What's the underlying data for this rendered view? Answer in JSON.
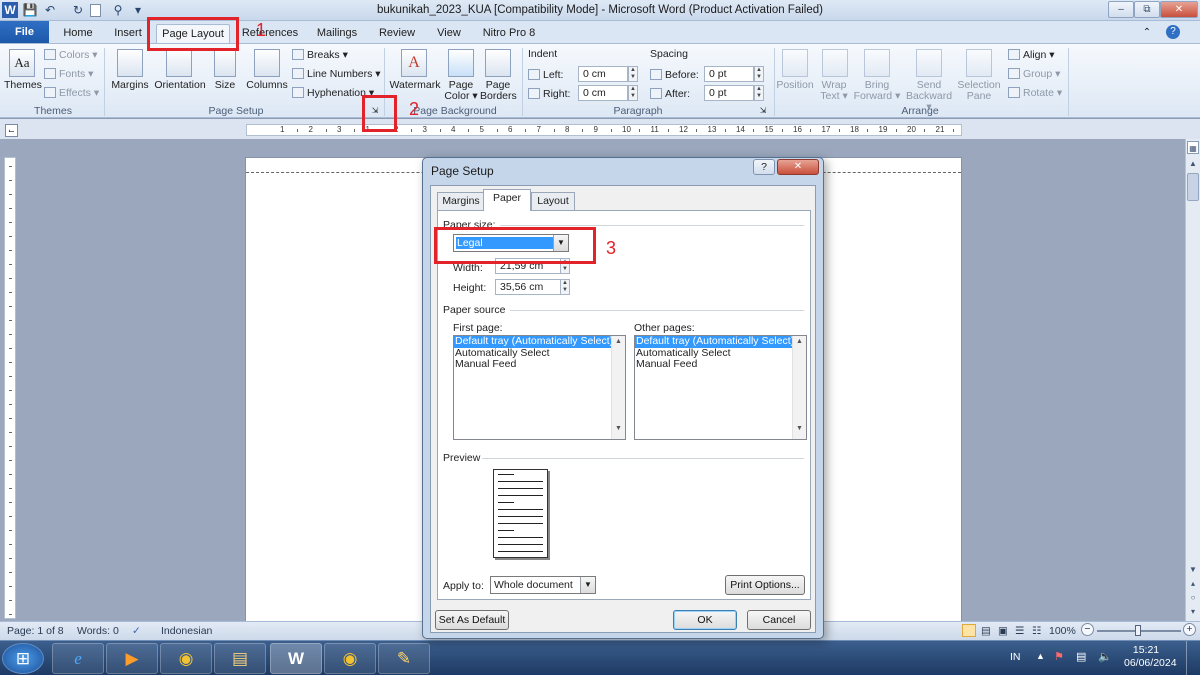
{
  "window": {
    "title": "bukunikah_2023_KUA [Compatibility Mode]  -  Microsoft Word (Product Activation Failed)",
    "minimize_glyph": "‒",
    "restore_glyph": "⧉",
    "close_glyph": "✕"
  },
  "quick_access": {
    "word_icon": "W",
    "save_icon": "💾",
    "undo_icon": "↶",
    "redo_icon": "↻",
    "dropdown_icon": "▾"
  },
  "tabs": [
    "File",
    "Home",
    "Insert",
    "Page Layout",
    "References",
    "Mailings",
    "Review",
    "View",
    "Nitro Pro 8"
  ],
  "ribbon": {
    "themes": {
      "themes": "Themes",
      "colors": "Colors",
      "fonts": "Fonts",
      "effects": "Effects",
      "group": "Themes"
    },
    "page_setup": {
      "margins": "Margins",
      "orientation": "Orientation",
      "size": "Size",
      "columns": "Columns",
      "breaks": "Breaks",
      "line_numbers": "Line Numbers",
      "hyphenation": "Hyphenation",
      "group": "Page Setup"
    },
    "page_background": {
      "watermark": "Watermark",
      "page_color_1": "Page",
      "page_color_2": "Color",
      "page_borders_1": "Page",
      "page_borders_2": "Borders",
      "group": "Page Background"
    },
    "paragraph": {
      "indent": "Indent",
      "spacing": "Spacing",
      "left_label": "Left:",
      "left_value": "0 cm",
      "right_label": "Right:",
      "right_value": "0 cm",
      "before_label": "Before:",
      "before_value": "0 pt",
      "after_label": "After:",
      "after_value": "0 pt",
      "group": "Paragraph"
    },
    "arrange": {
      "position": "Position",
      "wrap_1": "Wrap",
      "wrap_2": "Text",
      "bring_1": "Bring",
      "bring_2": "Forward",
      "send_1": "Send",
      "send_2": "Backward",
      "sel_1": "Selection",
      "sel_2": "Pane",
      "align": "Align",
      "group_btn": "Group",
      "rotate": "Rotate",
      "group": "Arrange"
    }
  },
  "ruler_numbers": [
    "1",
    "2",
    "3",
    "1",
    "2",
    "3",
    "4",
    "5",
    "6",
    "7",
    "8",
    "9",
    "10",
    "11",
    "12",
    "13",
    "14",
    "15",
    "16",
    "17",
    "18",
    "19",
    "20",
    "21"
  ],
  "dialog": {
    "title": "Page Setup",
    "help": "?",
    "close": "✕",
    "tabs": [
      "Margins",
      "Paper",
      "Layout"
    ],
    "paper_size_label": "Paper size:",
    "paper_size_value": "Legal",
    "width_label": "Width:",
    "width_value": "21,59 cm",
    "height_label": "Height:",
    "height_value": "35,56 cm",
    "paper_source_label": "Paper source",
    "first_page_label": "First page:",
    "other_pages_label": "Other pages:",
    "first_page_options": [
      "Default tray (Automatically Select)",
      "Automatically Select",
      "Manual Feed"
    ],
    "other_pages_options": [
      "Default tray (Automatically Select)",
      "Automatically Select",
      "Manual Feed"
    ],
    "preview_label": "Preview",
    "apply_to_label": "Apply to:",
    "apply_to_value": "Whole document",
    "print_options": "Print Options...",
    "set_default": "Set As Default",
    "ok": "OK",
    "cancel": "Cancel"
  },
  "annotations": {
    "step1": "1",
    "step2": "2",
    "step3": "3",
    "color": "#e2232a"
  },
  "status": {
    "page": "Page: 1 of 8",
    "words": "Words: 0",
    "language": "Indonesian",
    "zoom": "100%"
  },
  "taskbar": {
    "apps": [
      {
        "name": "start",
        "glyph": "⊞"
      },
      {
        "name": "internet-explorer",
        "glyph": "e"
      },
      {
        "name": "media-player",
        "glyph": "▶"
      },
      {
        "name": "chrome",
        "glyph": "◉"
      },
      {
        "name": "file-explorer",
        "glyph": "▤"
      },
      {
        "name": "word",
        "glyph": "W"
      },
      {
        "name": "chrome-2",
        "glyph": "◉"
      },
      {
        "name": "paint",
        "glyph": "✎"
      }
    ],
    "lang": "IN",
    "time": "15:21",
    "date": "06/06/2024"
  }
}
